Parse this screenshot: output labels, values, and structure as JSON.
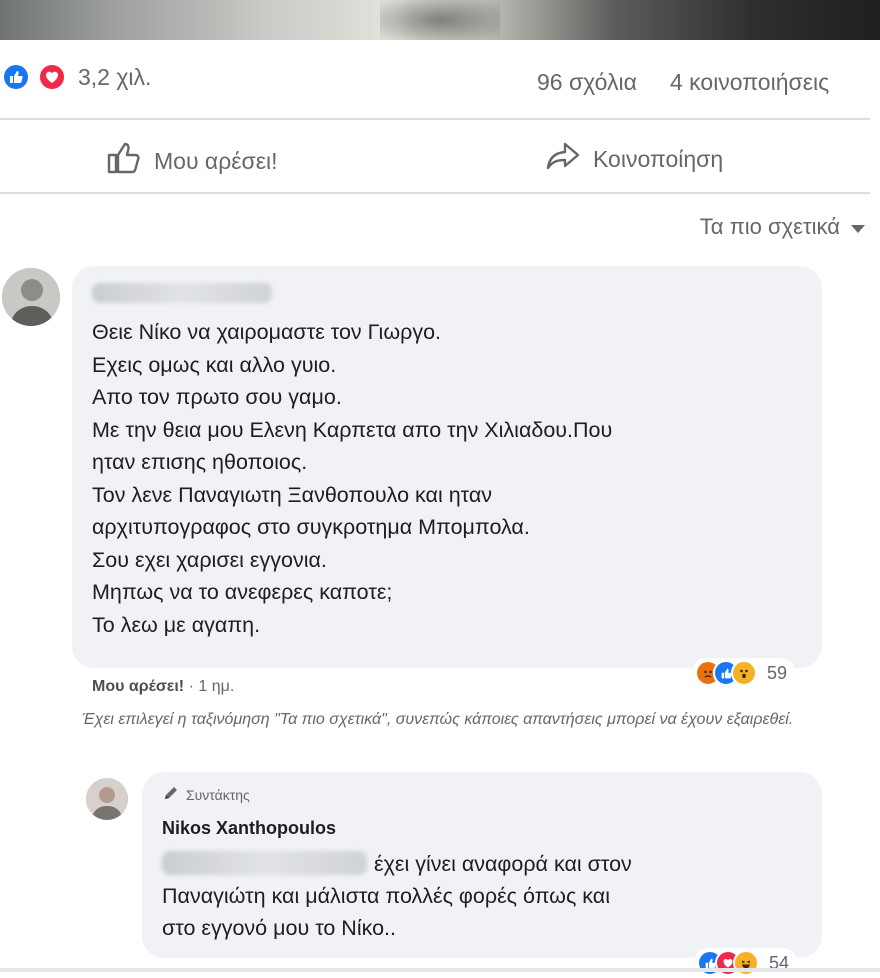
{
  "stats": {
    "reactions_count": "3,2 χιλ.",
    "comments": "96 σχόλια",
    "shares": "4 κοινοποιήσεις"
  },
  "actions": {
    "like_label": "Μου αρέσει!",
    "share_label": "Κοινοποίηση"
  },
  "sort": {
    "label": "Τα πιο σχετικά"
  },
  "comment": {
    "lines": [
      "Θειε Νίκο να χαιρομαστε τον Γιωργο.",
      "Εχεις ομως και αλλο γυιο.",
      "Απο τον πρωτο σου γαμο.",
      "Με την θεια μου Ελενη Καρπετα απο την Χιλιαδου.Που",
      "ηταν επισης ηθοποιος.",
      "Τον λενε Παναγιωτη Ξανθοπουλο και ηταν",
      "αρχιτυπογραφος στο συγκροτημα Μπομπολα.",
      "Σου εχει χαρισει εγγονια.",
      "Μηπως να το ανεφερες καποτε;",
      "Το λεω με αγαπη."
    ],
    "reaction_count": "59",
    "like_link": "Μου αρέσει!",
    "time": "· 1 ημ."
  },
  "sort_notice": "Έχει επιλεγεί η ταξινόμηση \"Τα πιο σχετικά\", συνεπώς κάποιες απαντήσεις μπορεί να έχουν εξαιρεθεί.",
  "reply": {
    "badge": "Συντάκτης",
    "author": "Nikos Xanthopoulos",
    "lines": [
      "έχει γίνει αναφορά και στον",
      "Παναγιώτη και μάλιστα πολλές φορές όπως και",
      "στο εγγονό μου το Νίκο.."
    ],
    "reaction_count": "54"
  },
  "colors": {
    "like_blue": "#1877f2",
    "love_red": "#f0284a",
    "haha_yellow": "#f7b125",
    "angry_orange": "#e9710f",
    "bubble_bg": "#f0f2f5",
    "muted_text": "#65676b"
  }
}
